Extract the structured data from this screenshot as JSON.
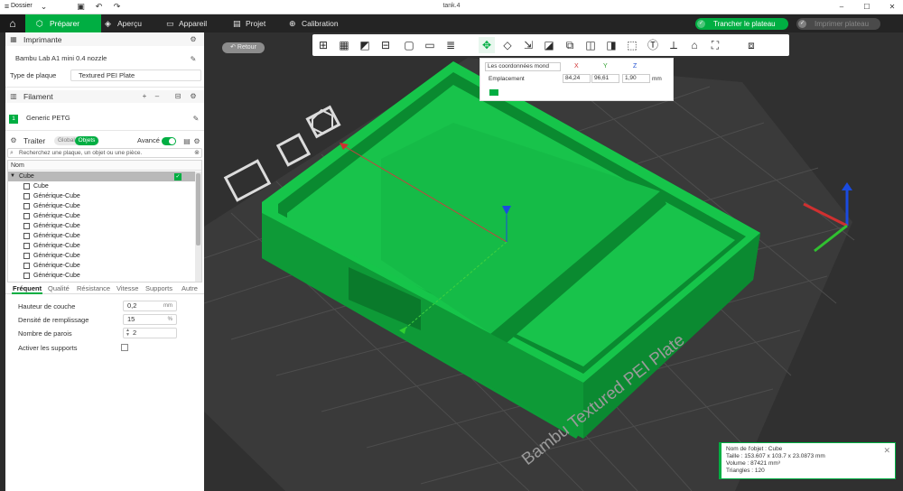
{
  "titlebar": {
    "menu_label": "Dossier",
    "title": "tank.4"
  },
  "nav": {
    "home_icon": "home-icon",
    "tabs": [
      {
        "label": "Préparer",
        "icon": "cube-icon",
        "active": true
      },
      {
        "label": "Aperçu",
        "icon": "layers-icon",
        "active": false
      },
      {
        "label": "Appareil",
        "icon": "device-icon",
        "active": false
      },
      {
        "label": "Projet",
        "icon": "project-icon",
        "active": false
      },
      {
        "label": "Calibration",
        "icon": "calibration-icon",
        "active": false
      }
    ],
    "slice_label": "Trancher le plateau",
    "print_label": "Imprimer plateau"
  },
  "printer": {
    "section_title": "Imprimante",
    "printer_name": "Bambu Lab A1 mini 0.4 nozzle",
    "plate_label": "Type de plaque",
    "plate_value": "Textured PEI Plate"
  },
  "filament": {
    "section_title": "Filament",
    "index": "1",
    "name": "Generic PETG"
  },
  "process": {
    "section_title": "Traiter",
    "seg_global": "Global",
    "seg_objects": "Objets",
    "advanced_label": "Avancé",
    "search_placeholder": "Recherchez une plaque, un objet ou une pièce.",
    "list_header": "Nom",
    "objects": [
      {
        "label": "Cube",
        "level": 0
      },
      {
        "label": "Cube",
        "level": 1
      },
      {
        "label": "Générique-Cube",
        "level": 1
      },
      {
        "label": "Générique-Cube",
        "level": 1
      },
      {
        "label": "Générique-Cube",
        "level": 1
      },
      {
        "label": "Générique-Cube",
        "level": 1
      },
      {
        "label": "Générique-Cube",
        "level": 1
      },
      {
        "label": "Générique-Cube",
        "level": 1
      },
      {
        "label": "Générique-Cube",
        "level": 1
      },
      {
        "label": "Générique-Cube",
        "level": 1
      },
      {
        "label": "Générique-Cube",
        "level": 1
      }
    ]
  },
  "settings_tabs": [
    "Fréquent",
    "Qualité",
    "Résistance",
    "Vitesse",
    "Supports",
    "Autre"
  ],
  "settings": {
    "layer_height": {
      "label": "Hauteur de couche",
      "value": "0,2",
      "unit": "mm"
    },
    "infill": {
      "label": "Densité de remplissage",
      "value": "15",
      "unit": "%"
    },
    "walls": {
      "label": "Nombre de parois",
      "value": "2"
    },
    "supports": {
      "label": "Activer les supports",
      "checked": false
    }
  },
  "viewport": {
    "back_label": "Retour",
    "coords": {
      "dropdown": "Les coordonnées mond",
      "x_label": "X",
      "y_label": "Y",
      "z_label": "Z",
      "row_label": "Emplacement",
      "x": "84,24",
      "y": "96,61",
      "z": "1,90",
      "unit": "mm"
    },
    "plate_text": "Bambu Textured PEI Plate",
    "model_color": "#15c24a",
    "info": {
      "name": "Nom de l'objet : Cube",
      "size": "Taille : 153.607 x 103.7 x 23.0873 mm",
      "volume": "Volume : 87421 mm³",
      "triangles": "Triangles : 120"
    }
  },
  "colors": {
    "accent": "#00ae42",
    "nav_bg": "#242424",
    "viewport_bg": "#303030"
  }
}
